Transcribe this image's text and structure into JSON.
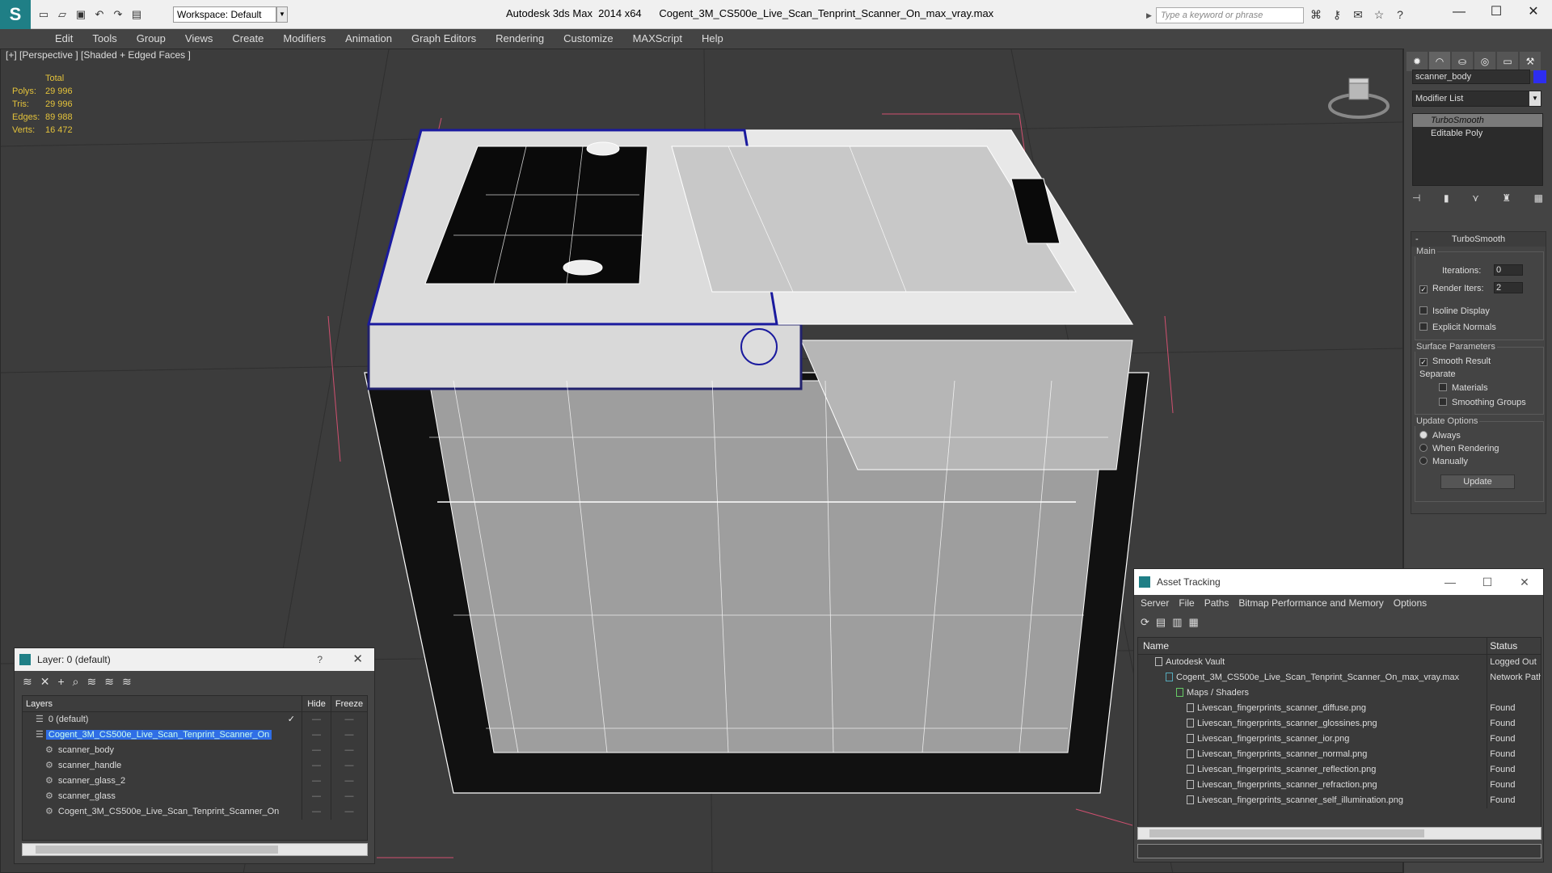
{
  "titlebar": {
    "app_title": "Autodesk 3ds Max  2014 x64",
    "file_title": "Cogent_3M_CS500e_Live_Scan_Tenprint_Scanner_On_max_vray.max",
    "workspace": "Workspace: Default",
    "search_placeholder": "Type a keyword or phrase"
  },
  "menu": [
    "Edit",
    "Tools",
    "Group",
    "Views",
    "Create",
    "Modifiers",
    "Animation",
    "Graph Editors",
    "Rendering",
    "Customize",
    "MAXScript",
    "Help"
  ],
  "viewport": {
    "label": "[+] [Perspective ] [Shaded + Edged Faces ]",
    "stats": {
      "header": "Total",
      "rows": [
        {
          "k": "Polys:",
          "v": "29 996"
        },
        {
          "k": "Tris:",
          "v": "29 996"
        },
        {
          "k": "Edges:",
          "v": "89 988"
        },
        {
          "k": "Verts:",
          "v": "16 472"
        }
      ]
    }
  },
  "command_panel": {
    "object_name": "scanner_body",
    "object_color": "#2d2df0",
    "modifier_list": "Modifier List",
    "stack": [
      "TurboSmooth",
      "Editable Poly"
    ],
    "rollout_title": "TurboSmooth",
    "main_label": "Main",
    "iterations_label": "Iterations:",
    "iterations_value": "0",
    "render_iters_label": "Render Iters:",
    "render_iters_value": "2",
    "isoline_label": "Isoline Display",
    "explicit_normals_label": "Explicit Normals",
    "surface_params_label": "Surface Parameters",
    "smooth_result_label": "Smooth Result",
    "separate_label": "Separate",
    "materials_label": "Materials",
    "smoothing_groups_label": "Smoothing Groups",
    "update_options_label": "Update Options",
    "always_label": "Always",
    "when_rendering_label": "When Rendering",
    "manually_label": "Manually",
    "update_button": "Update"
  },
  "layer_window": {
    "title": "Layer: 0 (default)",
    "help": "?",
    "col_layers": "Layers",
    "col_hide": "Hide",
    "col_freeze": "Freeze",
    "rows": [
      {
        "name": "0 (default)",
        "indent": 1,
        "sel": false,
        "check": "✓"
      },
      {
        "name": "Cogent_3M_CS500e_Live_Scan_Tenprint_Scanner_On",
        "indent": 1,
        "sel": true,
        "check": ""
      },
      {
        "name": "scanner_body",
        "indent": 2,
        "sel": false,
        "check": ""
      },
      {
        "name": "scanner_handle",
        "indent": 2,
        "sel": false,
        "check": ""
      },
      {
        "name": "scanner_glass_2",
        "indent": 2,
        "sel": false,
        "check": ""
      },
      {
        "name": "scanner_glass",
        "indent": 2,
        "sel": false,
        "check": ""
      },
      {
        "name": "Cogent_3M_CS500e_Live_Scan_Tenprint_Scanner_On",
        "indent": 2,
        "sel": false,
        "check": ""
      }
    ]
  },
  "asset_window": {
    "title": "Asset Tracking",
    "menu": [
      "Server",
      "File",
      "Paths",
      "Bitmap Performance and Memory",
      "Options"
    ],
    "col_name": "Name",
    "col_status": "Status",
    "rows": [
      {
        "name": "Autodesk Vault",
        "indent": 1,
        "status": "Logged Out"
      },
      {
        "name": "Cogent_3M_CS500e_Live_Scan_Tenprint_Scanner_On_max_vray.max",
        "indent": 2,
        "status": "Network Path"
      },
      {
        "name": "Maps / Shaders",
        "indent": 3,
        "status": ""
      },
      {
        "name": "Livescan_fingerprints_scanner_diffuse.png",
        "indent": 4,
        "status": "Found"
      },
      {
        "name": "Livescan_fingerprints_scanner_glossines.png",
        "indent": 4,
        "status": "Found"
      },
      {
        "name": "Livescan_fingerprints_scanner_ior.png",
        "indent": 4,
        "status": "Found"
      },
      {
        "name": "Livescan_fingerprints_scanner_normal.png",
        "indent": 4,
        "status": "Found"
      },
      {
        "name": "Livescan_fingerprints_scanner_reflection.png",
        "indent": 4,
        "status": "Found"
      },
      {
        "name": "Livescan_fingerprints_scanner_refraction.png",
        "indent": 4,
        "status": "Found"
      },
      {
        "name": "Livescan_fingerprints_scanner_self_illumination.png",
        "indent": 4,
        "status": "Found"
      }
    ]
  }
}
